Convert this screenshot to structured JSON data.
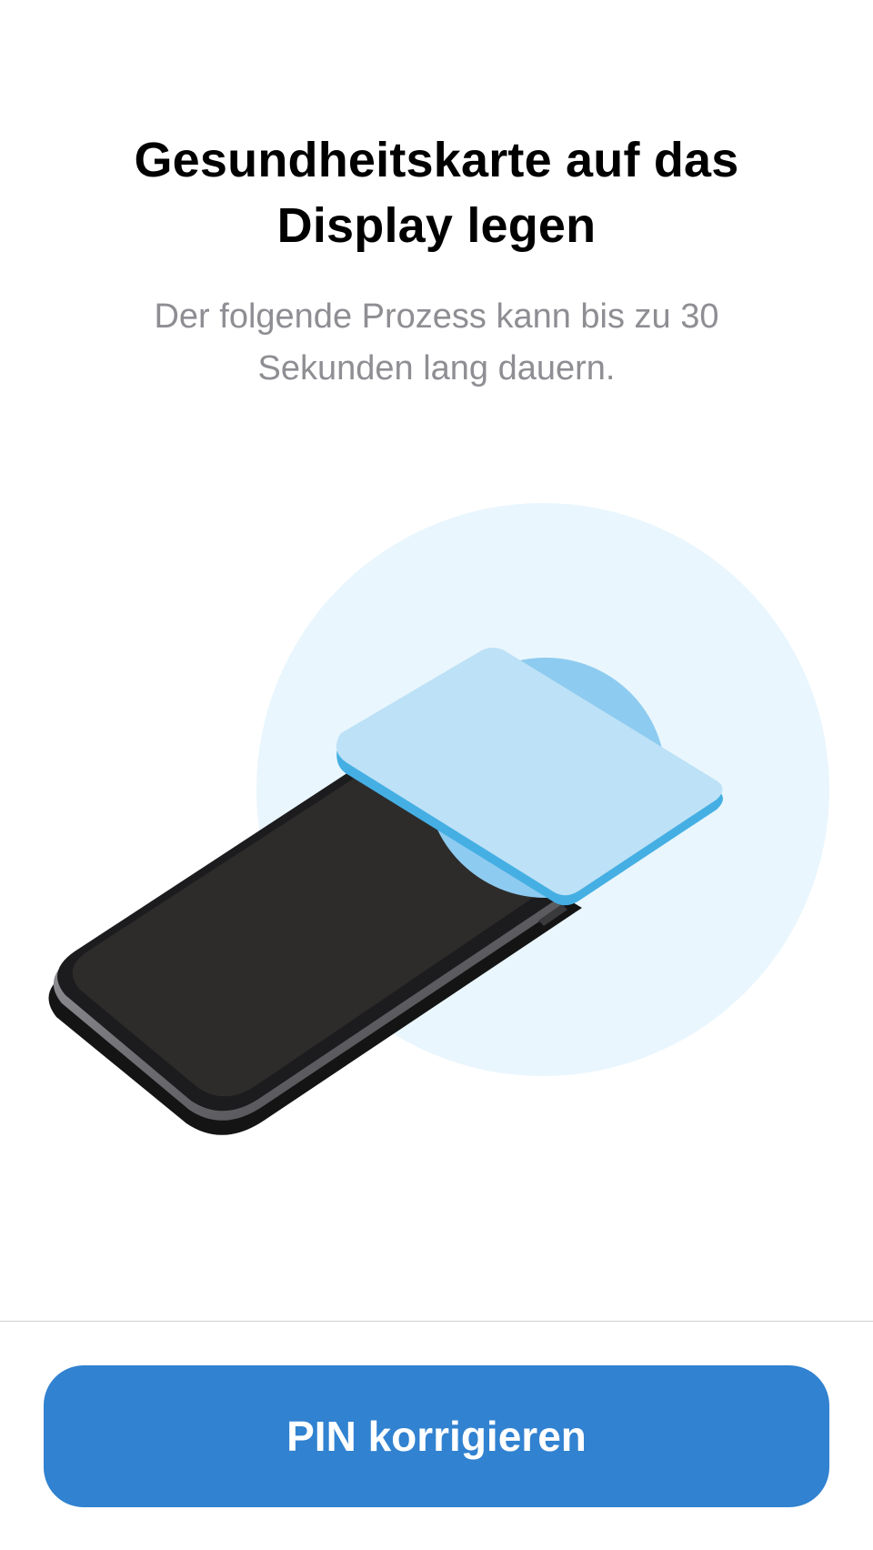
{
  "header": {
    "title": "Gesundheitskarte auf das Display legen",
    "subtitle": "Der folgende Prozess kann bis zu 30 Sekunden lang dauern."
  },
  "illustration": {
    "icon": "phone-with-card-illustration",
    "colors": {
      "halo": "#e9f6fd",
      "nfc_zone": "#8ecbf0",
      "card": "#bde1f6",
      "card_edge": "#45afe3",
      "phone_screen": "#2d2c2b",
      "phone_body": "#1c1c1e"
    }
  },
  "footer": {
    "button_label": "PIN korrigieren",
    "button_color": "#3182d0"
  }
}
